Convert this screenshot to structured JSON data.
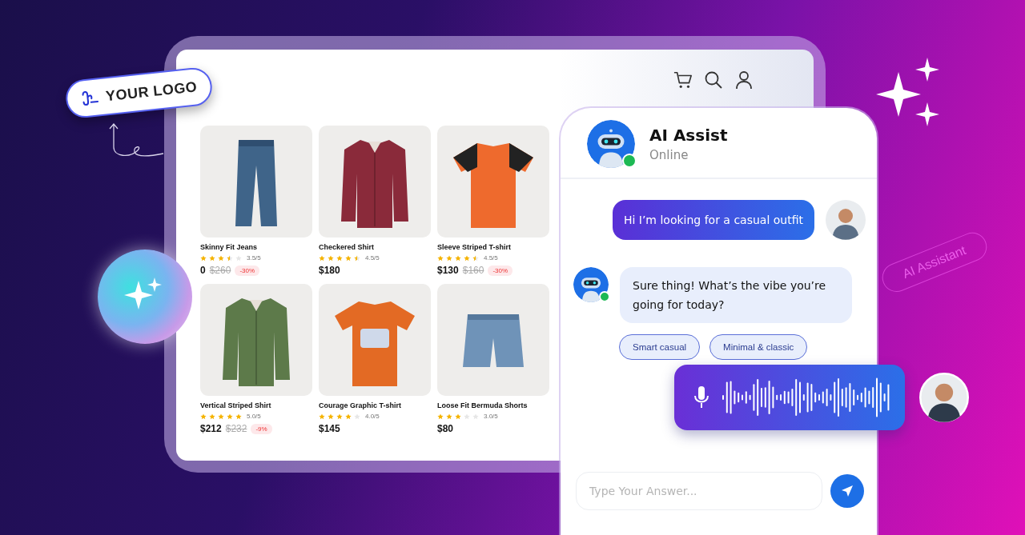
{
  "logo": {
    "text": "YOUR LOGO"
  },
  "products": [
    {
      "name": "Skinny Fit Jeans",
      "stars": 3.5,
      "rating": "3.5/5",
      "price": "0",
      "old_price": "$260",
      "discount": "-30%"
    },
    {
      "name": "Checkered Shirt",
      "stars": 4.5,
      "rating": "4.5/5",
      "price": "$180"
    },
    {
      "name": "Sleeve Striped T-shirt",
      "stars": 4.5,
      "rating": "4.5/5",
      "price": "$130",
      "old_price": "$160",
      "discount": "-30%"
    },
    {
      "name": "Vertical Striped Shirt",
      "stars": 5,
      "rating": "5.0/5",
      "price": "$212",
      "old_price": "$232",
      "discount": "-9%"
    },
    {
      "name": "Courage Graphic T-shirt",
      "stars": 4,
      "rating": "4.0/5",
      "price": "$145"
    },
    {
      "name": "Loose Fit Bermuda Shorts",
      "stars": 3,
      "rating": "3.0/5",
      "price": "$80"
    }
  ],
  "chat": {
    "title": "AI Assist",
    "status": "Online",
    "online": true,
    "messages": [
      {
        "kind": "user",
        "text": "Hi I’m looking for a casual outfit"
      },
      {
        "kind": "bot",
        "text": "Sure thing! What’s the vibe you’re going for today?",
        "suggestions": [
          "Smart casual",
          "Minimal & classic"
        ]
      },
      {
        "kind": "voice"
      }
    ],
    "input": {
      "placeholder": "Type Your Answer..."
    }
  },
  "tag": {
    "text": "AI Assistant"
  }
}
